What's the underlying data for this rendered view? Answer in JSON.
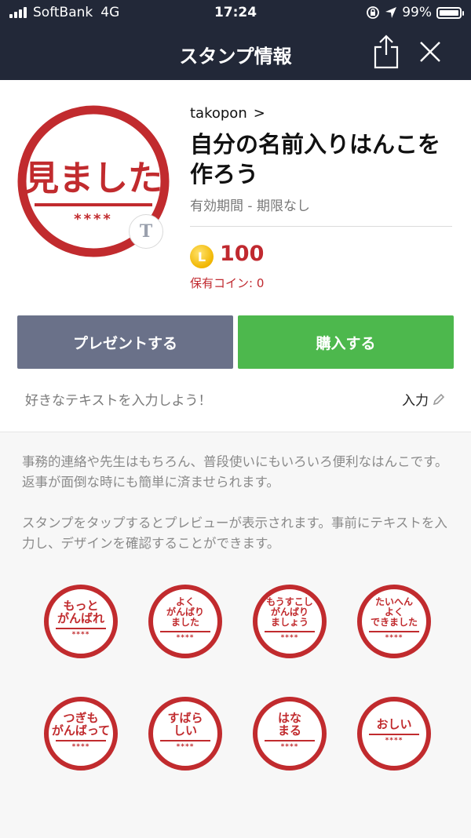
{
  "status_bar": {
    "carrier": "SoftBank",
    "network": "4G",
    "time": "17:24",
    "battery": "99%",
    "battery_level": 0.99
  },
  "header": {
    "title": "スタンプ情報",
    "share_icon": "share-icon",
    "close_icon": "close-icon"
  },
  "product": {
    "main_stamp_text": "見ました",
    "main_stamp_stars": "****",
    "author_badge": "T",
    "author": "takopon",
    "author_chevron": ">",
    "title": "自分の名前入りはんこを作ろう",
    "validity": "有効期間 - 期限なし",
    "coin_letter": "L",
    "price": "100",
    "owned_coins": "保有コイン: 0"
  },
  "actions": {
    "present_label": "プレゼントする",
    "buy_label": "購入する"
  },
  "custom_text": {
    "prompt": "好きなテキストを入力しよう！",
    "input_label": "入力"
  },
  "description": {
    "p1": "事務的連絡や先生はもちろん、普段使いにもいろいろ便利なはんこです。返事が面倒な時にも簡単に済ませられます。",
    "p2": "スタンプをタップするとプレビューが表示されます。事前にテキストを入力し、デザインを確認することができます。"
  },
  "stamps": [
    {
      "text": "もっと\nがんばれ",
      "stars": "****"
    },
    {
      "text": "よく\nがんばり\nました",
      "stars": "****"
    },
    {
      "text": "もうすこし\nがんばり\nましょう",
      "stars": "****"
    },
    {
      "text": "たいへん\nよく\nできました",
      "stars": "****"
    },
    {
      "text": "つぎも\nがんばって",
      "stars": "****"
    },
    {
      "text": "すばら\nしい",
      "stars": "****"
    },
    {
      "text": "はな\nまる",
      "stars": "****"
    },
    {
      "text": "おしい",
      "stars": "****"
    }
  ],
  "colors": {
    "header_bg": "#222838",
    "stamp_red": "#c12b2e",
    "present_btn": "#6a7189",
    "buy_btn": "#4db84d"
  }
}
